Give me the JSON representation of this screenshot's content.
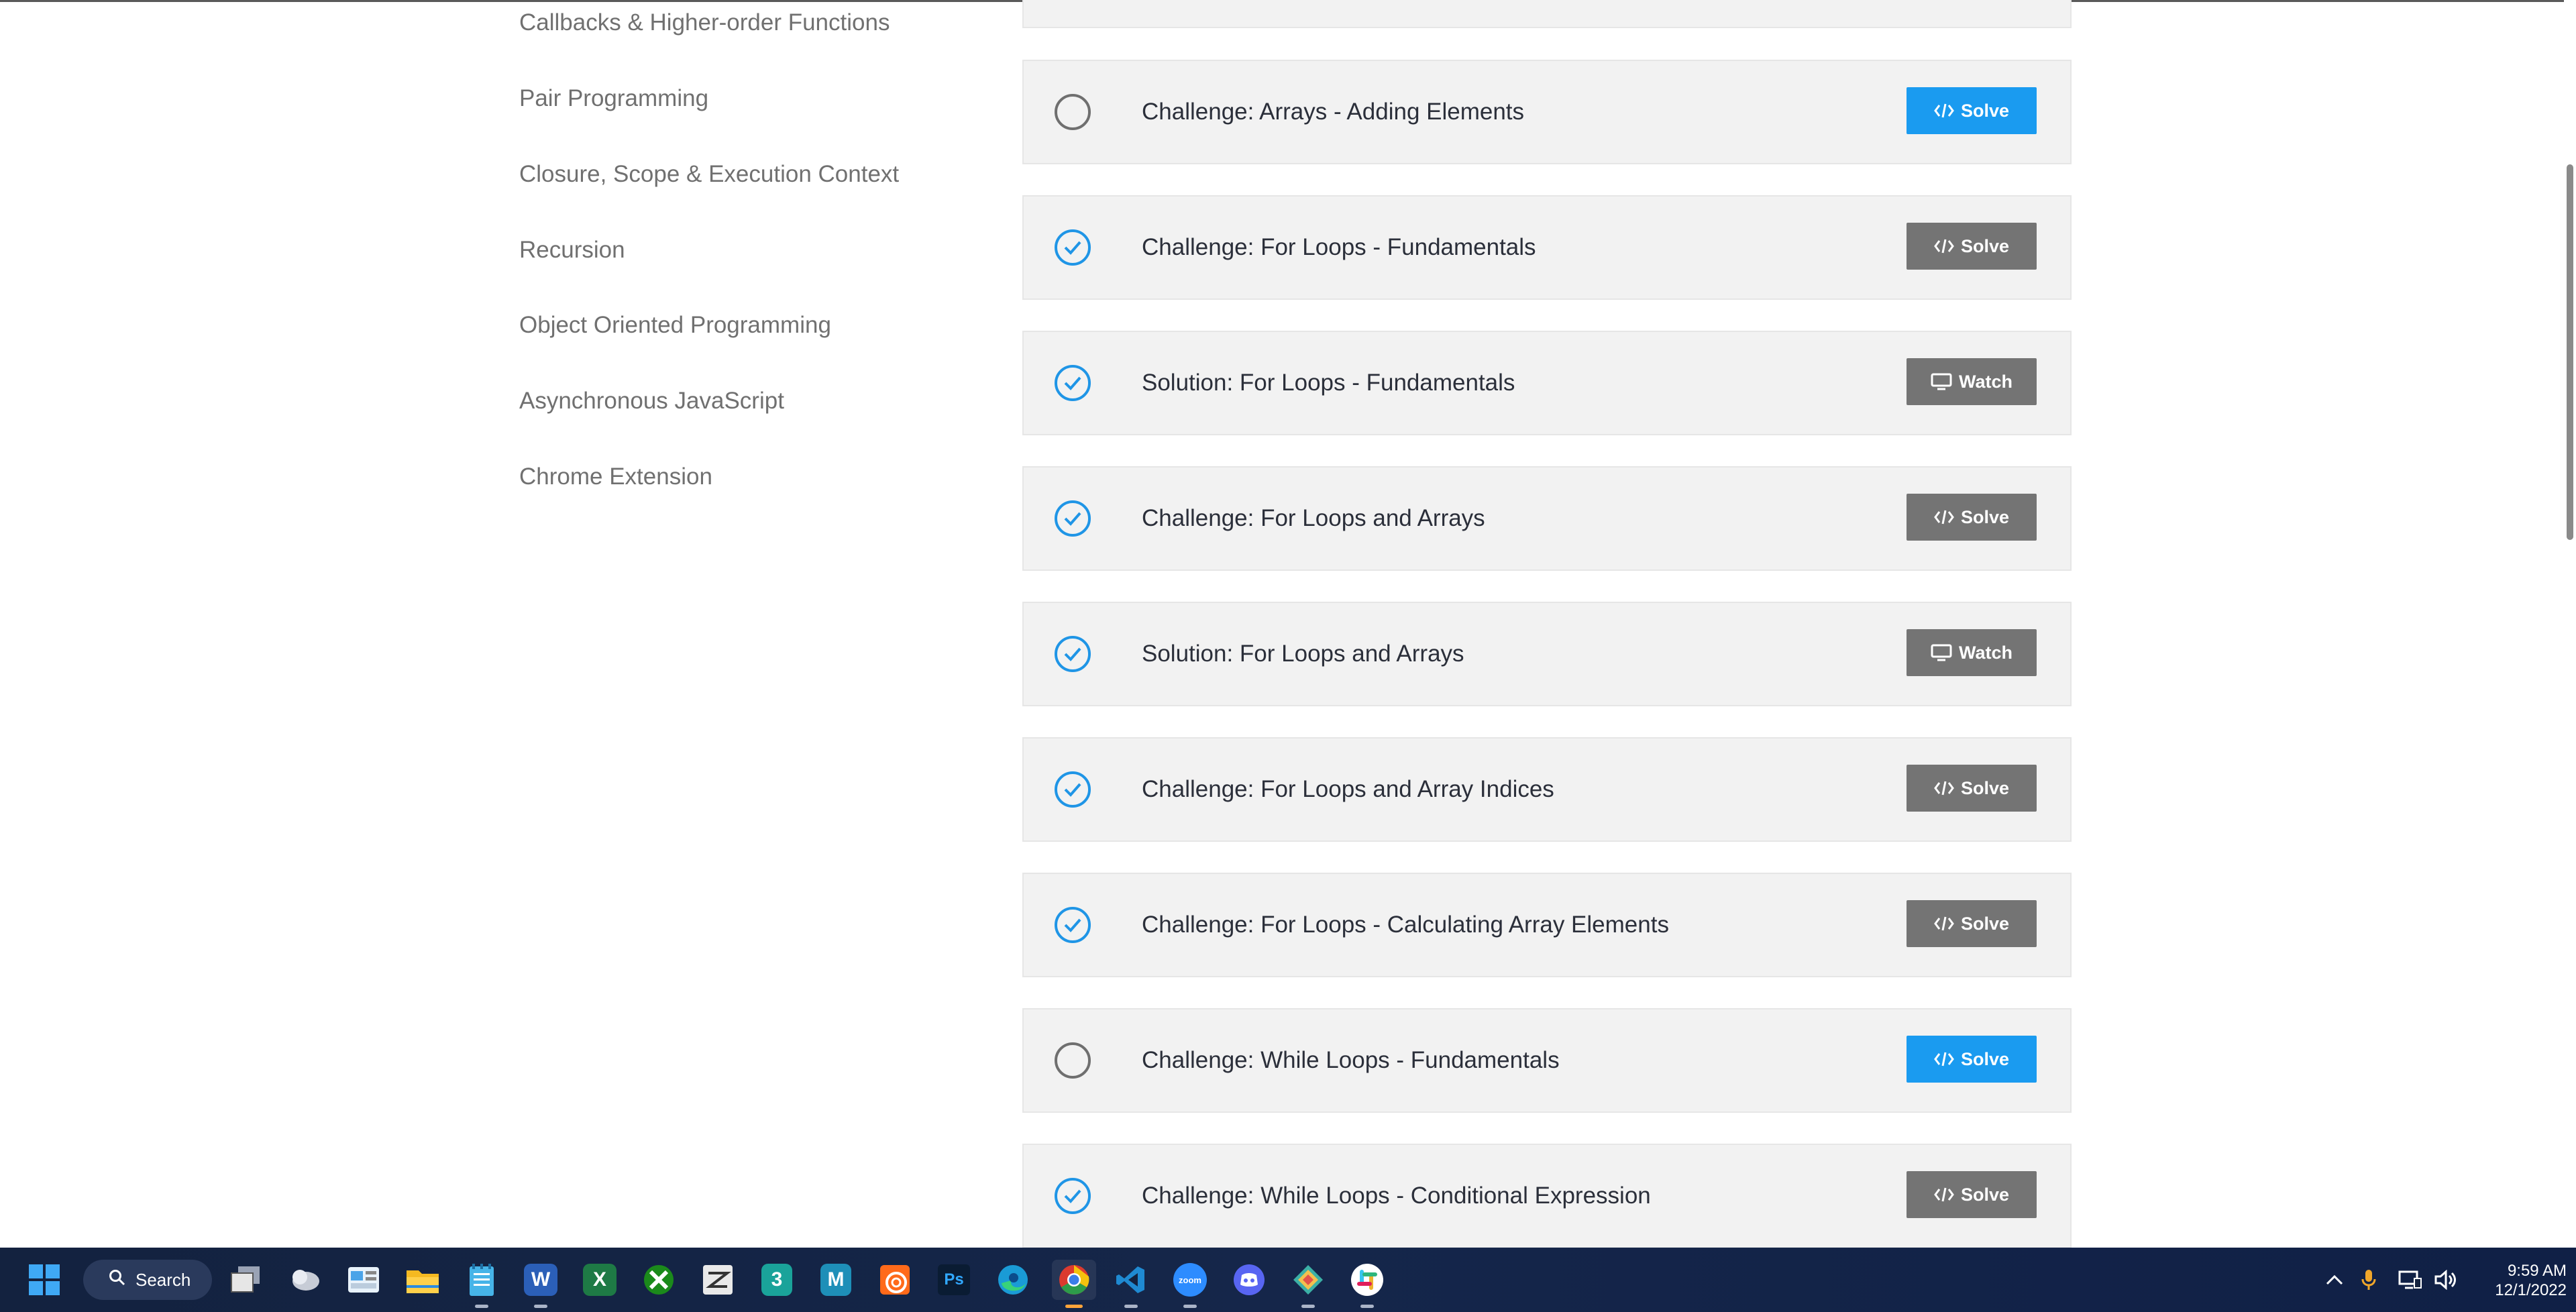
{
  "sidebar": {
    "items": [
      {
        "label": "Callbacks & Higher-order Functions"
      },
      {
        "label": "Pair Programming"
      },
      {
        "label": "Closure, Scope & Execution Context"
      },
      {
        "label": "Recursion"
      },
      {
        "label": "Object Oriented Programming"
      },
      {
        "label": "Asynchronous JavaScript"
      },
      {
        "label": "Chrome Extension"
      }
    ]
  },
  "lessons": [
    {
      "title": "Challenge: Arrays - Adding Elements",
      "completed": false,
      "action": "Solve",
      "action_icon": "code-icon",
      "style": "primary"
    },
    {
      "title": "Challenge: For Loops - Fundamentals",
      "completed": true,
      "action": "Solve",
      "action_icon": "code-icon",
      "style": "secondary"
    },
    {
      "title": "Solution: For Loops - Fundamentals",
      "completed": true,
      "action": "Watch",
      "action_icon": "monitor-icon",
      "style": "secondary"
    },
    {
      "title": "Challenge: For Loops and Arrays",
      "completed": true,
      "action": "Solve",
      "action_icon": "code-icon",
      "style": "secondary"
    },
    {
      "title": "Solution: For Loops and Arrays",
      "completed": true,
      "action": "Watch",
      "action_icon": "monitor-icon",
      "style": "secondary"
    },
    {
      "title": "Challenge: For Loops and Array Indices",
      "completed": true,
      "action": "Solve",
      "action_icon": "code-icon",
      "style": "secondary"
    },
    {
      "title": "Challenge: For Loops - Calculating Array Elements",
      "completed": true,
      "action": "Solve",
      "action_icon": "code-icon",
      "style": "secondary"
    },
    {
      "title": "Challenge: While Loops - Fundamentals",
      "completed": false,
      "action": "Solve",
      "action_icon": "code-icon",
      "style": "primary"
    },
    {
      "title": "Challenge: While Loops - Conditional Expression",
      "completed": true,
      "action": "Solve",
      "action_icon": "code-icon",
      "style": "secondary"
    }
  ],
  "colors": {
    "accent": "#1a9bf0",
    "check": "#1f95e6",
    "secondary_button": "#747474",
    "card_bg": "#f2f2f2",
    "taskbar_bg": "#13223f"
  },
  "taskbar": {
    "search_label": "Search",
    "apps": [
      "windows-start-icon",
      "task-view-icon",
      "widgets-icon",
      "weather-app-icon",
      "file-explorer-icon",
      "notepad-icon",
      "word-icon",
      "excel-icon",
      "xbox-icon",
      "zbrush-icon",
      "3ds-max-icon",
      "maya-icon",
      "houdini-icon",
      "photoshop-icon",
      "edge-icon",
      "chrome-icon",
      "vscode-icon",
      "zoom-icon",
      "discord-icon",
      "gitkraken-icon",
      "slack-icon"
    ],
    "zoom_label": "zoom",
    "tray_icons": [
      "chevron-up-icon",
      "microphone-icon",
      "network-icon",
      "volume-icon"
    ],
    "time": "9:59 AM",
    "date": "12/1/2022"
  }
}
